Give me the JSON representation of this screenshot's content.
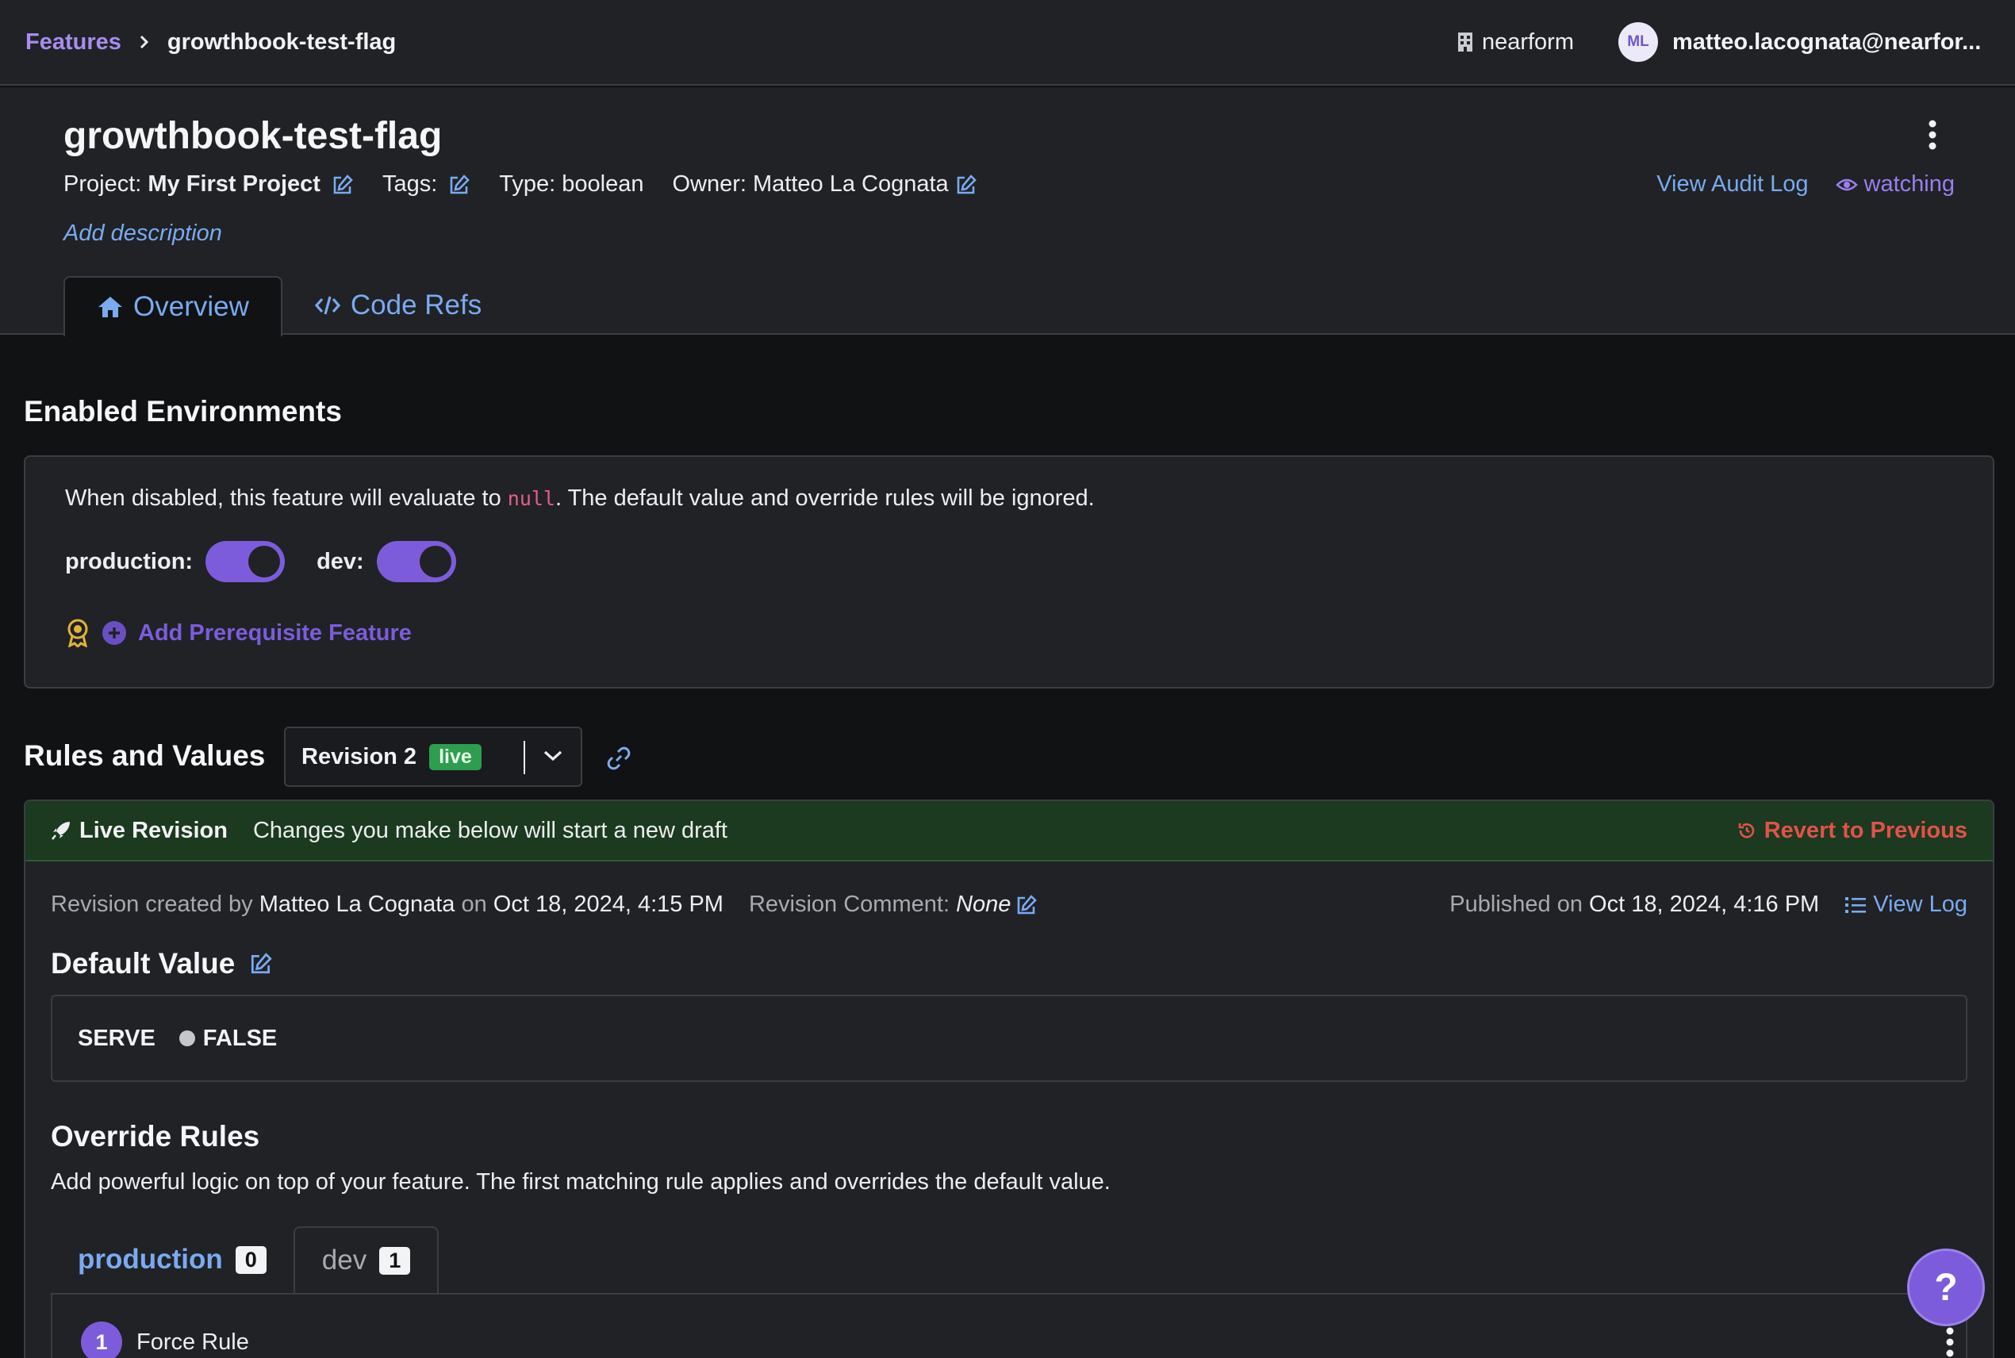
{
  "topbar": {
    "breadcrumb_root": "Features",
    "breadcrumb_current": "growthbook-test-flag",
    "org_name": "nearform",
    "avatar_initials": "ML",
    "user_email": "matteo.lacognata@nearfor..."
  },
  "feature": {
    "title": "growthbook-test-flag",
    "project_label": "Project:",
    "project_value": "My First Project",
    "tags_label": "Tags:",
    "type_text": "Type: boolean",
    "owner_text": "Owner: Matteo La Cognata",
    "audit_log": "View Audit Log",
    "watching": "watching",
    "add_description": "Add description"
  },
  "tabs": [
    {
      "label": "Overview",
      "icon": "home-icon"
    },
    {
      "label": "Code Refs",
      "icon": "code-icon"
    }
  ],
  "environments": {
    "heading": "Enabled Environments",
    "desc_before": "When disabled, this feature will evaluate to ",
    "desc_code": "null",
    "desc_after": ". The default value and override rules will be ignored.",
    "toggles": [
      {
        "label": "production:",
        "enabled": true
      },
      {
        "label": "dev:",
        "enabled": true
      }
    ],
    "add_prereq": "Add Prerequisite Feature"
  },
  "rules": {
    "heading": "Rules and Values",
    "revision_label": "Revision 2",
    "revision_badge": "live",
    "banner_title": "Live Revision",
    "banner_sub": "Changes you make below will start a new draft",
    "revert": "Revert to Previous",
    "created_prefix": "Revision created by ",
    "created_by": "Matteo La Cognata",
    "created_on_prefix": " on ",
    "created_on": "Oct 18, 2024, 4:15 PM",
    "comment_label": "Revision Comment:",
    "comment_value": "None",
    "published_prefix": "Published on ",
    "published_on": "Oct 18, 2024, 4:16 PM",
    "view_log": "View Log",
    "default_value_heading": "Default Value",
    "serve_label": "SERVE",
    "serve_value": "FALSE",
    "override_heading": "Override Rules",
    "override_desc": "Add powerful logic on top of your feature. The first matching rule applies and overrides the default value.",
    "env_tabs": [
      {
        "label": "production",
        "count": "0"
      },
      {
        "label": "dev",
        "count": "1"
      }
    ],
    "rule_number": "1",
    "rule_title": "Force Rule"
  },
  "help": {
    "label": "?"
  },
  "colors": {
    "accent_purple": "#7c5cdb",
    "link_blue": "#7aaaf0",
    "live_green": "#2e9d4f",
    "revert_red": "#e2524a",
    "banner_bg": "#1b3a1f"
  }
}
